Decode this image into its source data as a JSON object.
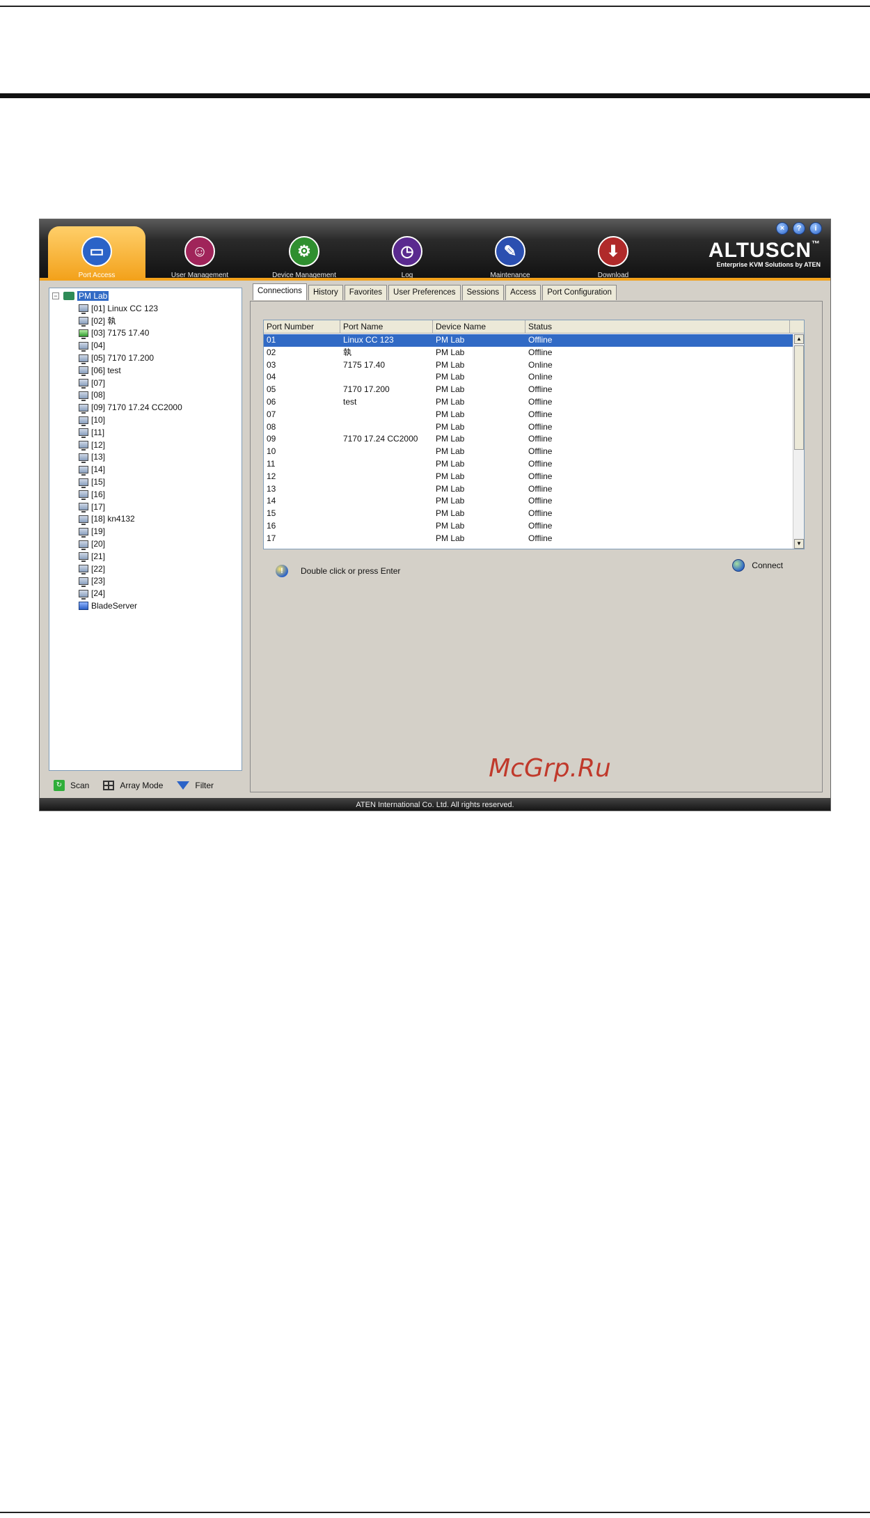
{
  "window_controls": [
    "×",
    "?",
    "i"
  ],
  "nav": [
    {
      "label": "Port Access",
      "icon": "port-access-icon",
      "color": "#2b63c7",
      "glyph": "▭"
    },
    {
      "label": "User Management",
      "icon": "user-management-icon",
      "color": "#a0245a",
      "glyph": "☺"
    },
    {
      "label": "Device Management",
      "icon": "device-management-icon",
      "color": "#2f8f2f",
      "glyph": "⚙"
    },
    {
      "label": "Log",
      "icon": "log-icon",
      "color": "#5a2a8f",
      "glyph": "◷"
    },
    {
      "label": "Maintenance",
      "icon": "maintenance-icon",
      "color": "#2b4fb0",
      "glyph": "✎"
    },
    {
      "label": "Download",
      "icon": "download-icon",
      "color": "#b02a2a",
      "glyph": "⬇"
    }
  ],
  "brand": {
    "name": "ALTUSCN",
    "tm": "™",
    "tagline": "Enterprise KVM Solutions by ATEN"
  },
  "tree": {
    "root_toggle": "−",
    "root_label": "PM Lab",
    "items": [
      {
        "label": "[01] Linux CC 123",
        "online": false
      },
      {
        "label": "[02] 執",
        "online": false
      },
      {
        "label": "[03] 7175 17.40",
        "online": true
      },
      {
        "label": "[04]",
        "online": false
      },
      {
        "label": "[05] 7170 17.200",
        "online": false
      },
      {
        "label": "[06] test",
        "online": false
      },
      {
        "label": "[07]",
        "online": false
      },
      {
        "label": "[08]",
        "online": false
      },
      {
        "label": "[09] 7170 17.24 CC2000",
        "online": false
      },
      {
        "label": "[10]",
        "online": false
      },
      {
        "label": "[11]",
        "online": false
      },
      {
        "label": "[12]",
        "online": false
      },
      {
        "label": "[13]",
        "online": false
      },
      {
        "label": "[14]",
        "online": false
      },
      {
        "label": "[15]",
        "online": false
      },
      {
        "label": "[16]",
        "online": false
      },
      {
        "label": "[17]",
        "online": false
      },
      {
        "label": "[18] kn4132",
        "online": false
      },
      {
        "label": "[19]",
        "online": false
      },
      {
        "label": "[20]",
        "online": false
      },
      {
        "label": "[21]",
        "online": false
      },
      {
        "label": "[22]",
        "online": false
      },
      {
        "label": "[23]",
        "online": false
      },
      {
        "label": "[24]",
        "online": false
      }
    ],
    "blade_label": "BladeServer"
  },
  "tools": {
    "scan": "Scan",
    "array_mode": "Array Mode",
    "filter": "Filter"
  },
  "tabs": [
    "Connections",
    "History",
    "Favorites",
    "User Preferences",
    "Sessions",
    "Access",
    "Port Configuration"
  ],
  "active_tab": 0,
  "grid": {
    "headers": [
      "Port Number",
      "Port Name",
      "Device Name",
      "Status"
    ],
    "rows": [
      [
        "01",
        "Linux CC 123",
        "PM Lab",
        "Offline"
      ],
      [
        "02",
        "執",
        "PM Lab",
        "Offline"
      ],
      [
        "03",
        "7175 17.40",
        "PM Lab",
        "Online"
      ],
      [
        "04",
        "",
        "PM Lab",
        "Online"
      ],
      [
        "05",
        "7170 17.200",
        "PM Lab",
        "Offline"
      ],
      [
        "06",
        "test",
        "PM Lab",
        "Offline"
      ],
      [
        "07",
        "",
        "PM Lab",
        "Offline"
      ],
      [
        "08",
        "",
        "PM Lab",
        "Offline"
      ],
      [
        "09",
        "7170 17.24 CC2000",
        "PM Lab",
        "Offline"
      ],
      [
        "10",
        "",
        "PM Lab",
        "Offline"
      ],
      [
        "11",
        "",
        "PM Lab",
        "Offline"
      ],
      [
        "12",
        "",
        "PM Lab",
        "Offline"
      ],
      [
        "13",
        "",
        "PM Lab",
        "Offline"
      ],
      [
        "14",
        "",
        "PM Lab",
        "Offline"
      ],
      [
        "15",
        "",
        "PM Lab",
        "Offline"
      ],
      [
        "16",
        "",
        "PM Lab",
        "Offline"
      ],
      [
        "17",
        "",
        "PM Lab",
        "Offline"
      ]
    ],
    "selected_row": 0,
    "scroll_up": "▲",
    "scroll_down": "▼"
  },
  "hint": "Double click or press Enter",
  "connect_label": "Connect",
  "watermark": "McGrp.Ru",
  "footer": "ATEN International Co. Ltd. All rights reserved."
}
